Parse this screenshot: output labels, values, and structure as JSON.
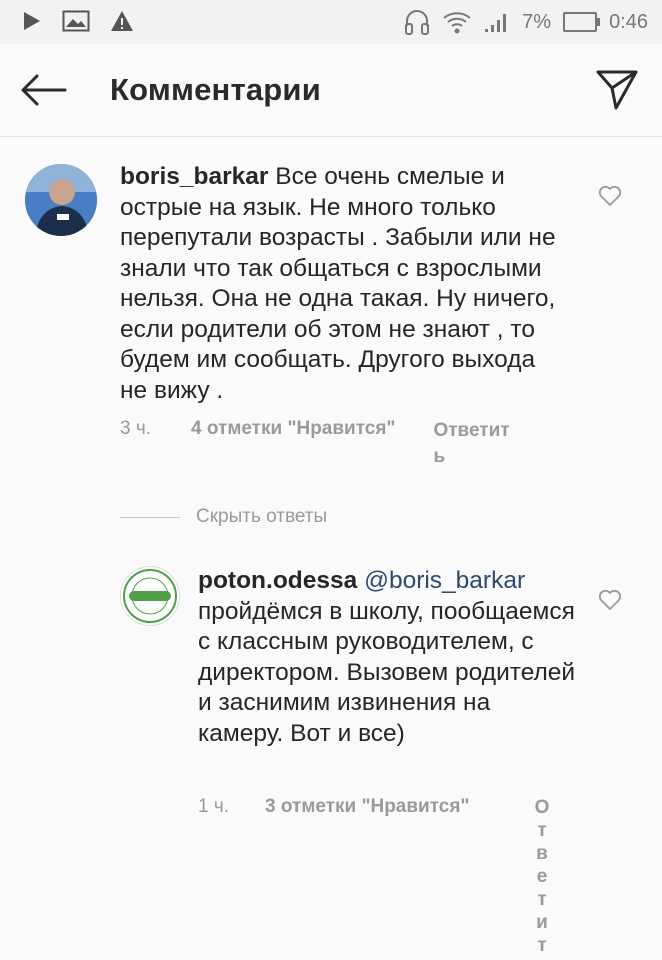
{
  "status_bar": {
    "icons_left": [
      "play-icon",
      "image-icon",
      "warning-icon"
    ],
    "icons_right": [
      "headphones-icon",
      "wifi-icon",
      "signal-icon",
      "battery-icon"
    ],
    "battery": "7%",
    "time": "0:46"
  },
  "header": {
    "title": "Комментарии"
  },
  "comments": [
    {
      "username": "boris_barkar",
      "text": " Все очень смелые и острые на язык. Не много только перепутали возрасты . Забыли или не знали что так общаться с взрослыми нельзя. Она не одна такая. Ну ничего, если родители об этом не знают , то будем им сообщать. Другого выхода не вижу .",
      "time": "3 ч.",
      "likes": "4 отметки \"Нравится\"",
      "reply_label": "Ответит",
      "reply_label_wrap": "ь"
    }
  ],
  "hide_replies_label": "Скрыть ответы",
  "replies": [
    {
      "username": "poton.odessa",
      "mention": "@boris_barkar",
      "text": "пройдёмся в школу, пообщаемся с классным руководителем, с директором. Вызовем родителей и заснимим извинения на камеру. Вот и все)",
      "time": "1 ч.",
      "likes": "3 отметки \"Нравится\"",
      "reply_label": "Ответит",
      "avatar_text": "POTON"
    }
  ]
}
